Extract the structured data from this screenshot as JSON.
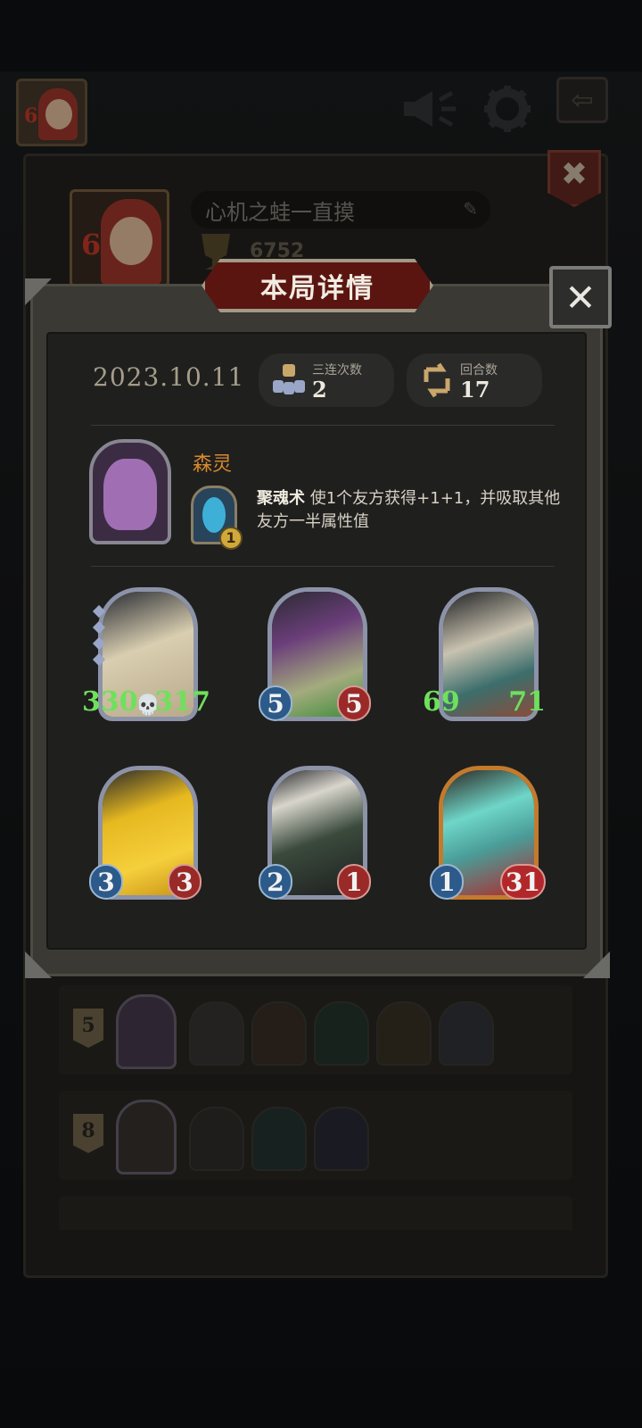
{
  "hud": {
    "player_level": "6",
    "sound_icon": "megaphone-icon",
    "settings_icon": "gear-icon",
    "exit_icon": "exit-arrow-icon"
  },
  "profile": {
    "level": "6",
    "name": "心机之蛙一直摸",
    "trophy": "6752"
  },
  "dialog": {
    "title": "本局详情",
    "date": "2023.10.11",
    "stats": [
      {
        "label": "三连次数",
        "value": "2",
        "icon": "triple-icon"
      },
      {
        "label": "回合数",
        "value": "17",
        "icon": "turns-icon"
      }
    ],
    "hero": {
      "name": "森灵",
      "power_cost": "1",
      "power_name": "聚魂术",
      "power_desc": "使1个友方获得+1+1，并吸取其他友方一半属性值"
    },
    "minions": [
      {
        "name": "bone-dragon",
        "attack": "330",
        "health": "317",
        "buffed": true,
        "gold": false
      },
      {
        "name": "purple-dragon",
        "attack": "5",
        "health": "5",
        "buffed": false,
        "gold": false
      },
      {
        "name": "blue-demon",
        "attack": "69",
        "health": "71",
        "buffed": true,
        "gold": false
      },
      {
        "name": "golden-statue",
        "attack": "3",
        "health": "3",
        "buffed": false,
        "gold": false
      },
      {
        "name": "hooded-necromancer",
        "attack": "2",
        "health": "1",
        "buffed": false,
        "gold": false
      },
      {
        "name": "spirit-summoner",
        "attack": "1",
        "health": "31",
        "buffed": false,
        "gold": true
      }
    ]
  },
  "history": [
    {
      "rank": "5"
    },
    {
      "rank": "8"
    }
  ],
  "colors": {
    "accent_orange": "#d78a2c",
    "banner_red": "#5b1510",
    "buff_green": "#6fe05c"
  }
}
